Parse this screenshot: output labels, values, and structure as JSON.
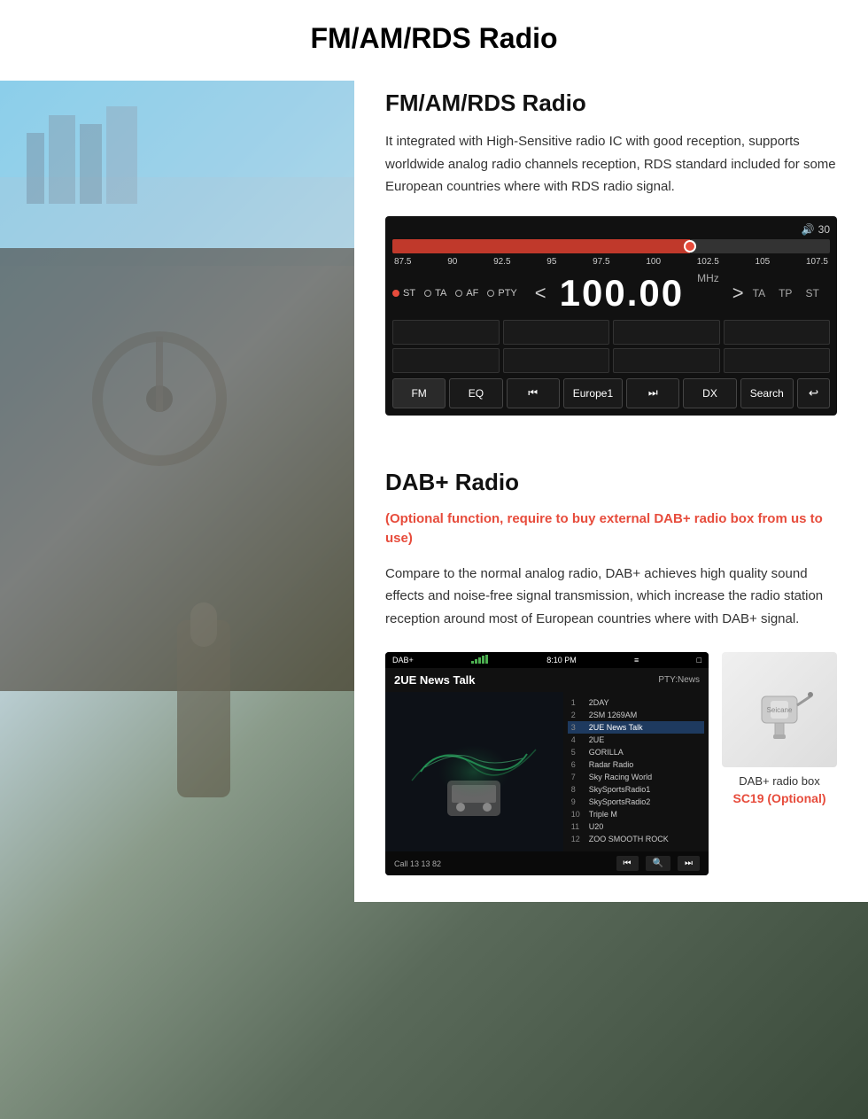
{
  "page": {
    "main_title": "FM/AM/RDS Radio",
    "header_divider": true
  },
  "fm_section": {
    "title": "FM/AM/RDS Radio",
    "description": "It integrated with High-Sensitive radio IC with good reception, supports worldwide analog radio channels reception, RDS standard included for some European countries where with RDS radio signal.",
    "radio_ui": {
      "volume_icon": "🔊",
      "volume_level": "30",
      "freq_labels": [
        "87.5",
        "90",
        "92.5",
        "95",
        "97.5",
        "100",
        "102.5",
        "105",
        "107.5"
      ],
      "options": [
        "ST",
        "TA",
        "AF",
        "PTY"
      ],
      "current_freq": "100.00",
      "unit": "MHz",
      "nav": {
        "prev": "<",
        "next": ">"
      },
      "right_options": [
        "TA",
        "TP",
        "ST"
      ],
      "buttons": [
        "FM",
        "EQ",
        "⏮",
        "Europe1",
        "⏭",
        "DX",
        "Search",
        "↩"
      ]
    }
  },
  "dab_section": {
    "title": "DAB+ Radio",
    "optional_text": "(Optional function, require to buy external DAB+ radio box from us to use)",
    "description": "Compare to the normal analog radio, DAB+ achieves high quality sound effects and noise-free signal transmission, which increase the radio station reception around most of European countries where with DAB+ signal.",
    "dab_ui": {
      "label": "DAB+",
      "time": "8:10 PM",
      "station": "2UE News Talk",
      "pty": "PTY:News",
      "station_list": [
        {
          "num": "1",
          "name": "2DAY"
        },
        {
          "num": "2",
          "name": "2SM 1269AM"
        },
        {
          "num": "3",
          "name": "2UE News Talk"
        },
        {
          "num": "4",
          "name": "2UE"
        },
        {
          "num": "5",
          "name": "GORILLA"
        },
        {
          "num": "6",
          "name": "Radar Radio"
        },
        {
          "num": "7",
          "name": "Sky Racing World"
        },
        {
          "num": "8",
          "name": "SkySportsRadio1"
        },
        {
          "num": "9",
          "name": "SkySportsRadio2"
        },
        {
          "num": "10",
          "name": "Triple M"
        },
        {
          "num": "11",
          "name": "U20"
        },
        {
          "num": "12",
          "name": "ZOO SMOOTH ROCK"
        }
      ],
      "call_text": "Call 13 13 82"
    },
    "dab_box": {
      "label": "DAB+ radio box",
      "model": "SC19 (Optional)"
    }
  }
}
